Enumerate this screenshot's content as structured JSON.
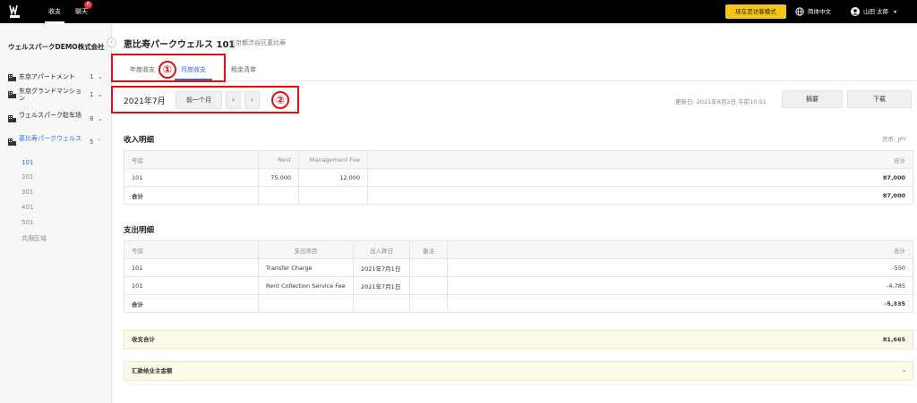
{
  "topbar": {
    "nav_income": "收支",
    "nav_chat": "聊天",
    "chat_badge": "6",
    "visitor_mode": "现在是访客模式",
    "language": "简体中文",
    "user": "山田 太郎"
  },
  "sidebar": {
    "company": "ウェルスパークDEMO株式会社",
    "properties": [
      {
        "name": "东京アパートメント",
        "count": "1",
        "chev": "v"
      },
      {
        "name": "东京グランドマンション",
        "count": "1",
        "chev": "v"
      },
      {
        "name": "ウェルスパーク駐车场",
        "count": "8",
        "chev": "v"
      },
      {
        "name": "恵比寿パークウェルス",
        "count": "5",
        "chev": "^"
      }
    ],
    "units": [
      "101",
      "201",
      "301",
      "401",
      "501",
      "共用区域"
    ]
  },
  "main": {
    "title": "恵比寿パークウェルス 101",
    "address": "东京都渋谷区恵比寿",
    "tabs": [
      "年度收支",
      "月度收支",
      "租金清单"
    ],
    "marker1": "①",
    "marker2": "②",
    "month": "2021年7月",
    "prev_month": "前一个月",
    "prev_arrow": "‹",
    "next_arrow": "›",
    "updated": "更新日: 2021年8月2日 午前10:51",
    "summary_btn": "摘要",
    "download_btn": "下载"
  },
  "income": {
    "title": "收入明细",
    "currency": "货币: JPY",
    "headers": [
      "号房",
      "Rent",
      "Management Fee",
      "合计"
    ],
    "row": [
      "101",
      "75,000",
      "12,000",
      "87,000"
    ],
    "total_label": "合计",
    "total_value": "87,000"
  },
  "expense": {
    "title": "支出明细",
    "headers": [
      "号房",
      "支出项目",
      "出入款日",
      "备注",
      "合计"
    ],
    "rows": [
      [
        "101",
        "Transfer Charge",
        "2021年7月1日",
        "",
        "-550"
      ],
      [
        "101",
        "Rent Collection Service Fee",
        "2021年7月1日",
        "",
        "-4,785"
      ]
    ],
    "total_label": "合计",
    "total_value": "-5,335"
  },
  "balance": {
    "label": "收支合计",
    "value": "81,665"
  },
  "remit": {
    "label": "汇款给业主金额",
    "value": "-"
  }
}
